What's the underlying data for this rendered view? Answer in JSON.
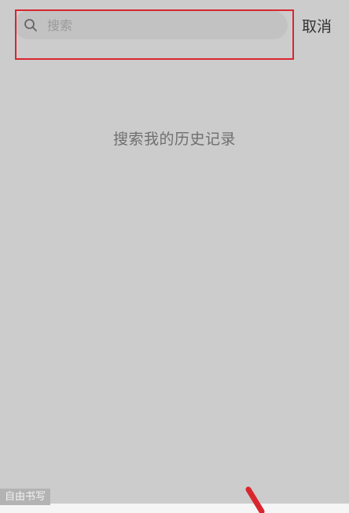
{
  "search": {
    "placeholder": "搜索",
    "cancel_label": "取消"
  },
  "main": {
    "history_hint": "搜索我的历史记录"
  },
  "overlay": {
    "freehand_label": "自由书写",
    "highlight_color": "#d9262e"
  },
  "icons": {
    "search": "search-icon"
  },
  "colors": {
    "background": "#cccccc",
    "search_pill": "#c2c2c2",
    "annotation_red": "#d9262e"
  }
}
